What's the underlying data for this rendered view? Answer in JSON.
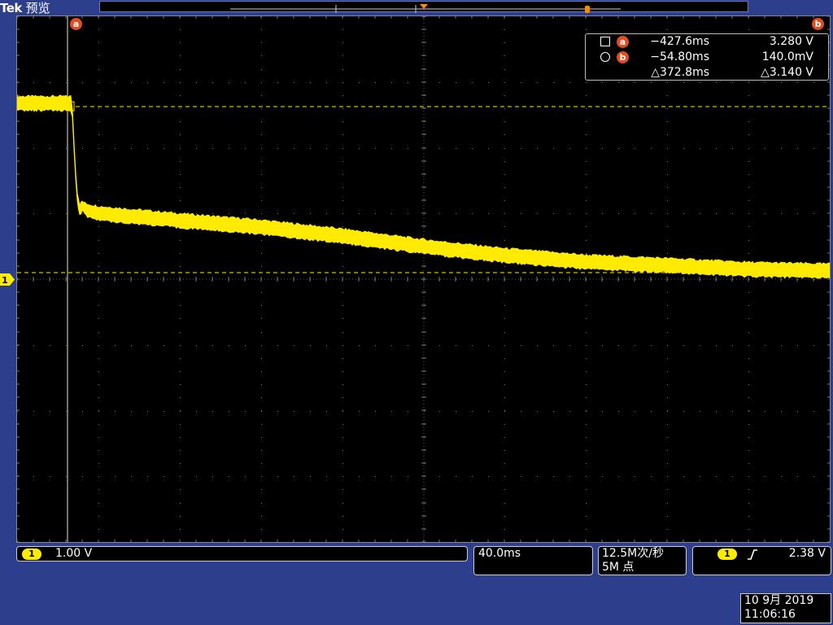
{
  "header": {
    "brand": "Tek",
    "mode": "预览"
  },
  "colors": {
    "trace": "#ffeb00",
    "cursor": "#e8e8c8",
    "background": "#2d3f8c",
    "badge": "#e04d1f"
  },
  "cursors": {
    "a_label": "a",
    "b_label": "b"
  },
  "readout": {
    "a": {
      "label": "a",
      "time": "−427.6ms",
      "value": "3.280 V"
    },
    "b": {
      "label": "b",
      "time": "−54.80ms",
      "value": "140.0mV"
    },
    "delta": {
      "time": "△372.8ms",
      "value": "△3.140 V"
    }
  },
  "channel1": {
    "label": "1",
    "scale": "1.00 V"
  },
  "timebase": {
    "scale": "40.0ms"
  },
  "acquisition": {
    "rate": "12.5M次/秒",
    "points": "5M 点"
  },
  "trigger": {
    "channel": "1",
    "slope_icon": "rising-edge-icon",
    "level": "2.38 V"
  },
  "datetime": {
    "date": "10 9月  2019",
    "time": "11:06:16"
  }
}
